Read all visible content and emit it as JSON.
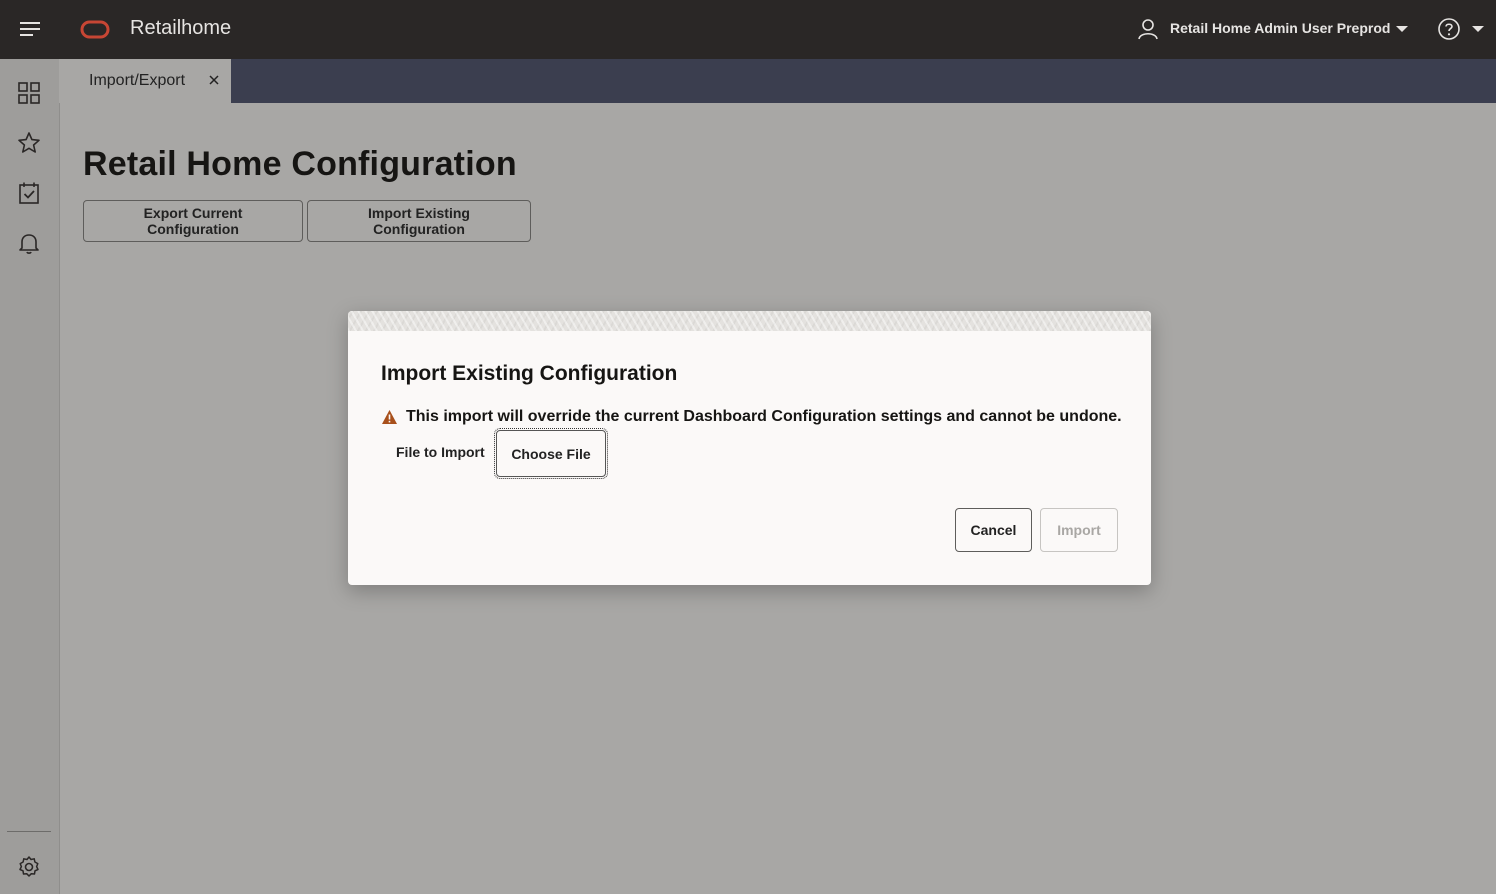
{
  "header": {
    "app_title": "Retailhome",
    "user_name": "Retail Home Admin User Preprod",
    "icons": [
      "hamburger-menu-icon",
      "oracle-logo",
      "user-icon",
      "chevron-down-icon",
      "help-icon",
      "chevron-down-icon"
    ]
  },
  "rail": {
    "icons": [
      "dashboard-grid-icon",
      "favorites-star-icon",
      "tasks-calendar-icon",
      "notifications-bell-icon",
      "settings-gear-icon"
    ]
  },
  "tabs": [
    {
      "label": "Import/Export",
      "closable": true
    }
  ],
  "page": {
    "title": "Retail Home Configuration",
    "export_button": "Export Current Configuration",
    "import_button": "Import Existing Configuration"
  },
  "dialog": {
    "title": "Import Existing Configuration",
    "warning": "This import will override the current Dashboard Configuration settings and cannot be undone.",
    "file_label": "File to Import",
    "choose_file": "Choose File",
    "cancel": "Cancel",
    "import": "Import",
    "import_enabled": false
  },
  "colors": {
    "header_bg": "#2a2726",
    "tabbar_bg": "#3b3e4f",
    "overlay_bg": "#a8a7a5",
    "logo_red": "#c74634",
    "warning_orange": "#a8501b"
  }
}
